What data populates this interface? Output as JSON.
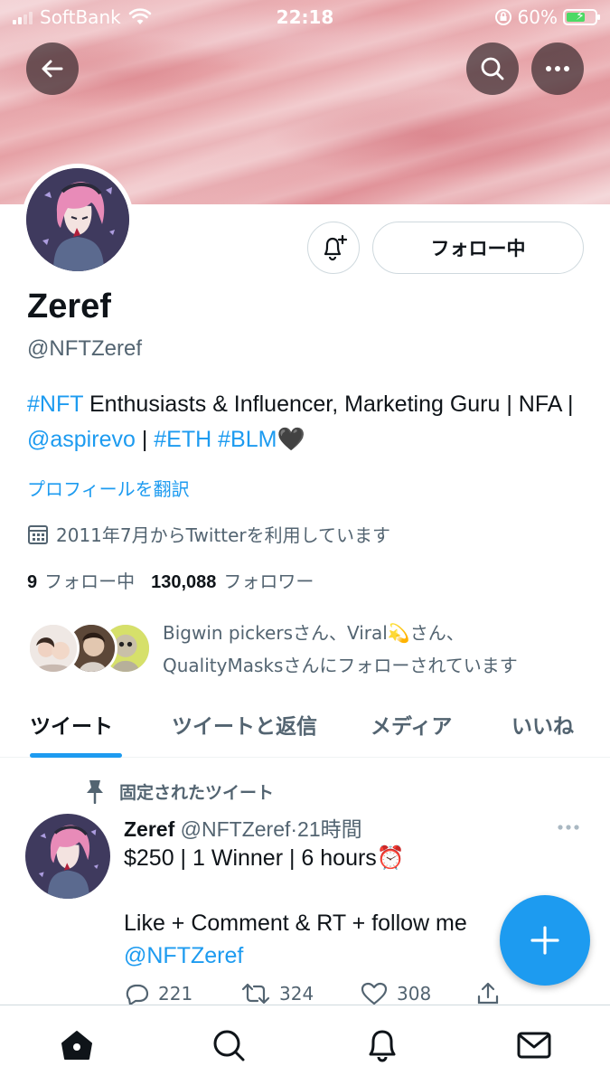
{
  "status_bar": {
    "carrier": "SoftBank",
    "time": "22:18",
    "battery_percent": "60%"
  },
  "profile": {
    "name": "Zeref",
    "handle": "@NFTZeref",
    "bio": {
      "tag_nft": "#NFT",
      "text1": " Enthusiasts & Influencer, Marketing Guru | NFA | ",
      "mention": "@aspirevo",
      "sep": " | ",
      "tag_eth": "#ETH",
      "space": " ",
      "tag_blm": "#BLM",
      "emoji": "🖤"
    },
    "translate_label": "プロフィールを翻訳",
    "joined": "2011年7月からTwitterを利用しています",
    "following_count": "9",
    "following_label": "フォロー中",
    "followers_count": "130,088",
    "followers_label": "フォロワー",
    "followed_by_line1": "Bigwin pickersさん、Viral💫さん、",
    "followed_by_line2": "QualityMasksさんにフォローされています"
  },
  "buttons": {
    "following_button": "フォロー中"
  },
  "tabs": [
    {
      "label": "ツイート",
      "active": true
    },
    {
      "label": "ツイートと返信",
      "active": false
    },
    {
      "label": "メディア",
      "active": false
    },
    {
      "label": "いいね",
      "active": false
    }
  ],
  "tweet": {
    "pinned_label": "固定されたツイート",
    "author_name": "Zeref",
    "author_handle": "@NFTZeref",
    "meta": "·21時間",
    "line1": "$250 | 1 Winner | 6 hours⏰",
    "line2": "Like + Comment & RT + follow me",
    "mention": "@NFTZeref",
    "replies": "221",
    "retweets": "324",
    "likes": "308"
  },
  "icons": {
    "back": "back-arrow-icon",
    "search": "search-icon",
    "more": "more-icon",
    "bell": "notification-bell-plus-icon",
    "calendar": "calendar-icon",
    "pin": "pin-icon",
    "reply": "reply-icon",
    "retweet": "retweet-icon",
    "like": "heart-icon",
    "share": "share-icon",
    "compose": "plus-icon",
    "home": "home-icon",
    "explore": "search-icon",
    "notifications": "bell-icon",
    "messages": "mail-icon"
  },
  "colors": {
    "accent": "#1d9bf0",
    "text": "#0f1419",
    "secondary": "#536471"
  }
}
